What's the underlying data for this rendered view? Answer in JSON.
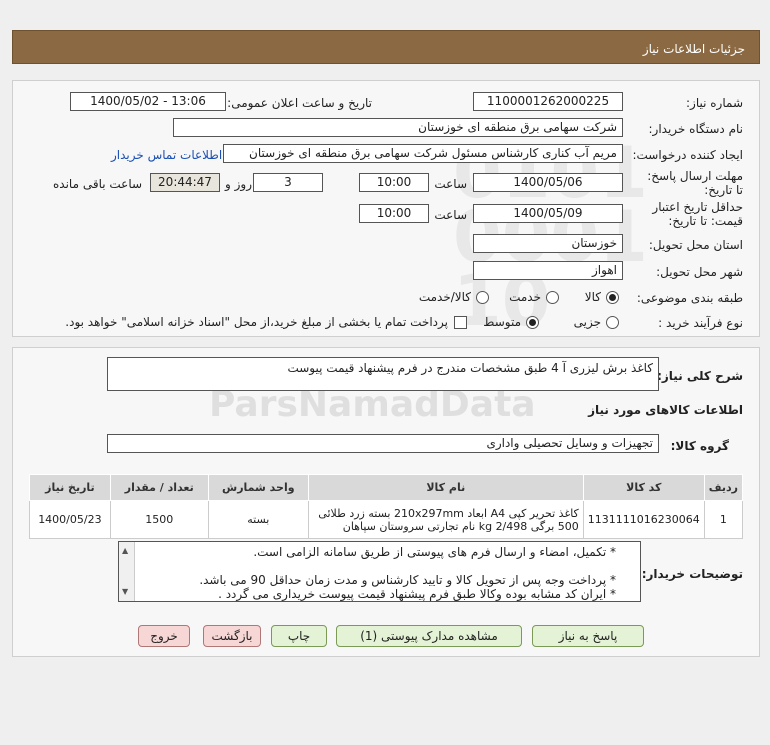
{
  "header": {
    "title": "جزئیات اطلاعات نیاز"
  },
  "form": {
    "need_number_label": "شماره نیاز:",
    "need_number": "1100001262000225",
    "announce_label": "تاریخ و ساعت اعلان عمومی:",
    "announce_value": "1400/05/02 - 13:06",
    "buyer_org_label": "نام دستگاه خریدار:",
    "buyer_org": "شرکت سهامی برق منطقه ای خوزستان",
    "creator_label": "ایجاد کننده درخواست:",
    "creator": "مریم آب کناری کارشناس مسئول شرکت سهامی برق منطقه ای خوزستان",
    "contact_link": "اطلاعات تماس خریدار",
    "deadline_label": "مهلت ارسال پاسخ: تا تاریخ:",
    "deadline_date": "1400/05/06",
    "time_label": "ساعت",
    "deadline_time": "10:00",
    "days_value": "3",
    "days_label": "روز و",
    "remaining_time": "20:44:47",
    "remaining_label": "ساعت باقی مانده",
    "validity_label": "حداقل تاریخ اعتبار قیمت: تا تاریخ:",
    "validity_date": "1400/05/09",
    "validity_time": "10:00",
    "province_label": "استان محل تحویل:",
    "province": "خوزستان",
    "city_label": "شهر محل تحویل:",
    "city": "اهواز",
    "category_label": "طبقه بندی موضوعی:",
    "category_options": [
      "کالا",
      "خدمت",
      "کالا/خدمت"
    ],
    "process_label": "نوع فرآیند خرید :",
    "process_options": [
      "جزیی",
      "متوسط"
    ],
    "payment_note": "پرداخت تمام یا بخشی از مبلغ خرید،از محل \"اسناد خزانه اسلامی\" خواهد بود."
  },
  "details": {
    "summary_label": "شرح کلی نیاز:",
    "summary": "کاغذ برش لیزری آ 4 طبق مشخصات مندرج در فرم پیشنهاد قیمت پیوست",
    "goods_info_title": "اطلاعات کالاهای مورد نیاز",
    "goods_group_label": "گروه کالا:",
    "goods_group": "تجهیزات و وسایل تحصیلی واداری",
    "table": {
      "headers": [
        "ردیف",
        "کد کالا",
        "نام کالا",
        "واحد شمارش",
        "تعداد / مقدار",
        "تاریخ نیاز"
      ],
      "rows": [
        {
          "index": "1",
          "code": "1131111016230064",
          "name": "کاغذ تحریر کپی A4 ابعاد 210x297mm بسته زرد طلائی 500 برگی 2/498 kg نام تجارتی سروستان سپاهان",
          "unit": "بسته",
          "qty": "1500",
          "date": "1400/05/23"
        }
      ]
    },
    "buyer_notes_label": "توضیحات خریدار:",
    "notes": [
      "* تکمیل، امضاء و ارسال فرم های پیوستی از طریق سامانه الزامی است.",
      "",
      "* پرداخت وجه پس از تحویل کالا و تایید کارشناس و مدت زمان حداقل 90  می باشد.",
      "* ایران کد مشابه بوده وکالا طبق فرم پیشنهاد قیمت پیوست خریداری می گردد ."
    ]
  },
  "buttons": {
    "reply": "پاسخ به نیاز",
    "attachments": "مشاهده مدارک پیوستی (1)",
    "print": "چاپ",
    "back": "بازگشت",
    "exit": "خروج"
  }
}
